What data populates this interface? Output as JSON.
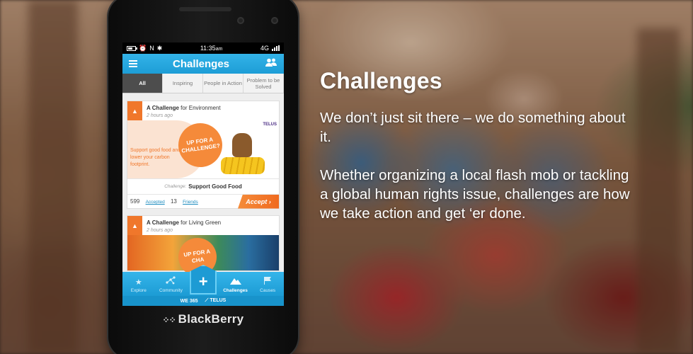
{
  "headline": "Challenges",
  "paragraphs": [
    "We don’t just sit there – we do something about it.",
    "Whether organizing a local flash mob or tackling a global human rights issue, challenges are how we take action and get ‘er done."
  ],
  "device": {
    "brand": "BlackBerry",
    "status_bar": {
      "time": "11:35",
      "ampm": "am",
      "network": "4G"
    },
    "app": {
      "title": "Challenges",
      "tabs": [
        {
          "label": "All",
          "active": true
        },
        {
          "label": "Inspiring",
          "active": false
        },
        {
          "label": "People in Action",
          "active": false
        },
        {
          "label": "Problem to be Solved",
          "active": false
        }
      ],
      "cards": [
        {
          "heading_prefix": "A Challenge",
          "heading_suffix": "for Environment",
          "time": "2 hours ago",
          "promo_text": "Support good food and lower your carbon footprint.",
          "promo_badge": "UP FOR A CHALLENGE?",
          "sponsor": "TELUS",
          "challenge_label": "Challenge:",
          "challenge_name": "Support Good Food",
          "accepted_count": "599",
          "accepted_label": "Accepted",
          "friends_count": "13",
          "friends_label": "Friends",
          "accept_button": "Accept"
        },
        {
          "heading_prefix": "A Challenge",
          "heading_suffix": "for Living Green",
          "time": "2 hours ago",
          "promo_badge": "UP FOR A CHA"
        }
      ],
      "bottom_nav": [
        {
          "label": "Explore",
          "icon": "star-icon"
        },
        {
          "label": "Community",
          "icon": "network-icon"
        },
        {
          "label": "",
          "icon": "plus-icon"
        },
        {
          "label": "Challenges",
          "icon": "mountain-icon",
          "active": true
        },
        {
          "label": "Causes",
          "icon": "flag-icon"
        }
      ],
      "footer": {
        "left": "WE 365",
        "right": "TELUS"
      }
    }
  },
  "colors": {
    "accent_blue": "#1d9dd6",
    "accent_orange": "#f0772b"
  }
}
